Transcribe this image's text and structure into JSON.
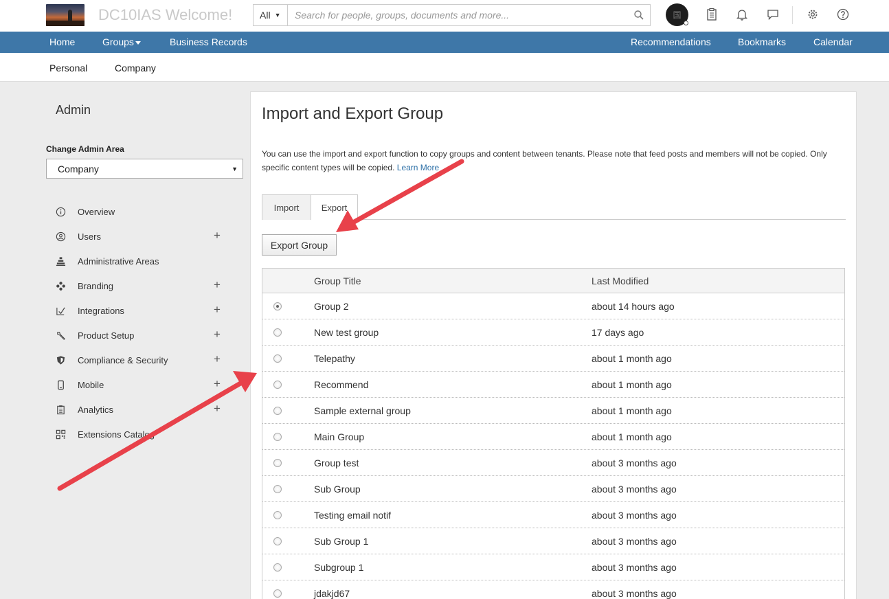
{
  "header": {
    "app_title": "DC10IAS Welcome!",
    "search_scope": "All",
    "search_placeholder": "Search for people, groups, documents and more...",
    "avatar_initial": "国"
  },
  "main_nav": {
    "home": "Home",
    "groups": "Groups",
    "business_records": "Business Records",
    "recommendations": "Recommendations",
    "bookmarks": "Bookmarks",
    "calendar": "Calendar"
  },
  "sub_nav": {
    "personal": "Personal",
    "company": "Company"
  },
  "sidebar": {
    "title": "Admin",
    "change_area_label": "Change Admin Area",
    "change_area_value": "Company",
    "items": [
      {
        "label": "Overview",
        "expandable": false
      },
      {
        "label": "Users",
        "expandable": true
      },
      {
        "label": "Administrative Areas",
        "expandable": false
      },
      {
        "label": "Branding",
        "expandable": true
      },
      {
        "label": "Integrations",
        "expandable": true
      },
      {
        "label": "Product Setup",
        "expandable": true
      },
      {
        "label": "Compliance & Security",
        "expandable": true
      },
      {
        "label": "Mobile",
        "expandable": true
      },
      {
        "label": "Analytics",
        "expandable": true
      },
      {
        "label": "Extensions Catalog",
        "expandable": false
      }
    ]
  },
  "panel": {
    "title": "Import and Export Group",
    "description": "You can use the import and export function to copy groups and content between tenants. Please note that feed posts and members will not be copied. Only specific content types will be copied.",
    "learn_more": "Learn More",
    "tabs": [
      "Import",
      "Export"
    ],
    "active_tab": "Export",
    "export_button": "Export Group",
    "table": {
      "headers": [
        "Group Title",
        "Last Modified"
      ],
      "selected_index": 0,
      "rows": [
        [
          "Group 2",
          "about 14 hours ago"
        ],
        [
          "New test group",
          "17 days ago"
        ],
        [
          "Telepathy",
          "about 1 month ago"
        ],
        [
          "Recommend",
          "about 1 month ago"
        ],
        [
          "Sample external group",
          "about 1 month ago"
        ],
        [
          "Main Group",
          "about 1 month ago"
        ],
        [
          "Group test",
          "about 3 months ago"
        ],
        [
          "Sub Group",
          "about 3 months ago"
        ],
        [
          "Testing email notif",
          "about 3 months ago"
        ],
        [
          "Sub Group 1",
          "about 3 months ago"
        ],
        [
          "Subgroup 1",
          "about 3 months ago"
        ],
        [
          "jdakjd67",
          "about 3 months ago"
        ]
      ]
    }
  },
  "colors": {
    "nav_blue": "#3e77a8",
    "link": "#2a6ea6",
    "annotation_arrow": "#e8414a"
  }
}
